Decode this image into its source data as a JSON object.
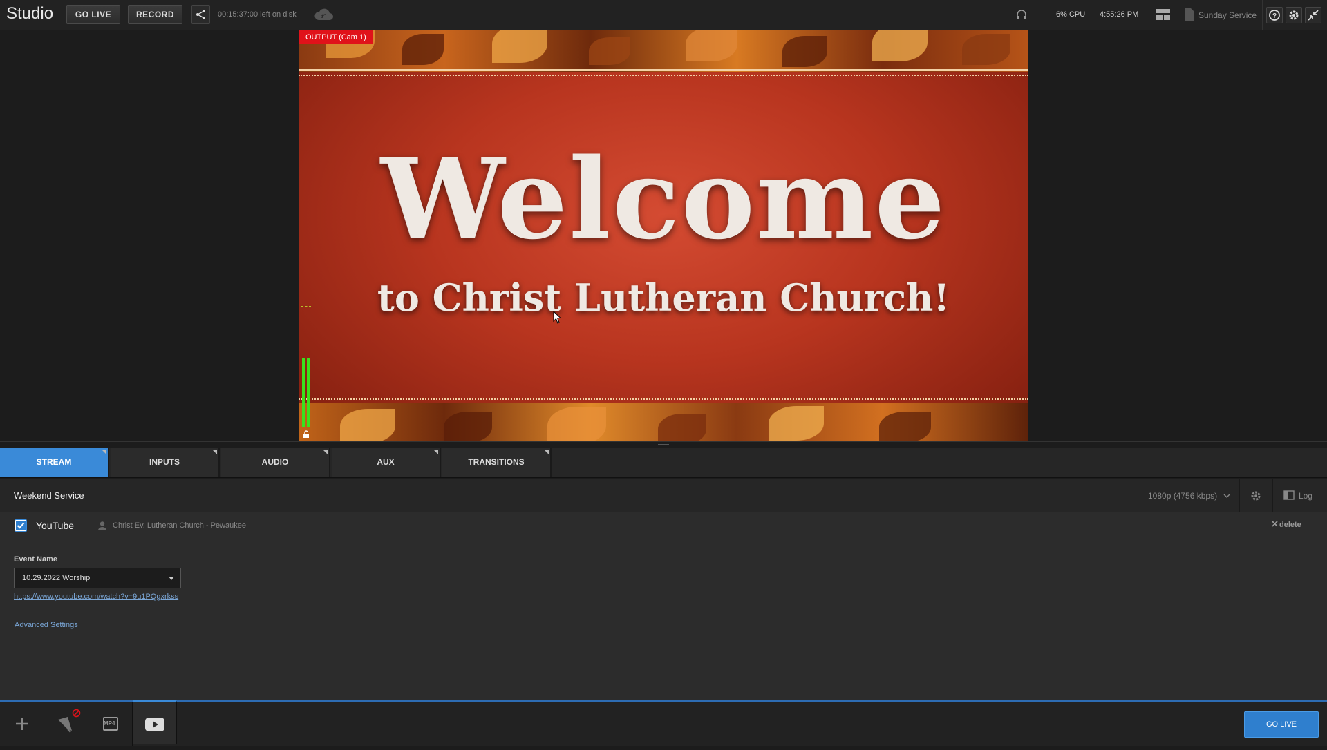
{
  "app": {
    "title": "Studio",
    "go_live_label": "GO LIVE",
    "record_label": "RECORD",
    "disk_remaining": "00:15:37:00 left on disk",
    "cpu": "6% CPU",
    "clock": "4:55:26 PM",
    "project_name": "Sunday Service"
  },
  "preview": {
    "output_label": "OUTPUT (Cam 1)",
    "headline": "Welcome",
    "subtitle": "to Christ Lutheran Church!"
  },
  "tabs": [
    {
      "label": "STREAM"
    },
    {
      "label": "INPUTS"
    },
    {
      "label": "AUDIO"
    },
    {
      "label": "AUX"
    },
    {
      "label": "TRANSITIONS"
    }
  ],
  "stream": {
    "title": "Weekend Service",
    "quality": "1080p (4756 kbps)",
    "log_label": "Log",
    "destination": {
      "platform": "YouTube",
      "checked": true,
      "account": "Christ Ev. Lutheran Church - Pewaukee",
      "delete_label": "delete"
    },
    "event_name_label": "Event Name",
    "event_name_value": "10.29.2022 Worship",
    "event_url": "https://www.youtube.com/watch?v=9u1PQgxrkss",
    "advanced_settings_label": "Advanced Settings"
  },
  "bottom": {
    "go_live_label": "GO LIVE",
    "mp4_label": "MP4"
  },
  "colors": {
    "accent": "#3a8ad8",
    "live_red": "#e0121a",
    "meter_green": "#39e21c"
  }
}
